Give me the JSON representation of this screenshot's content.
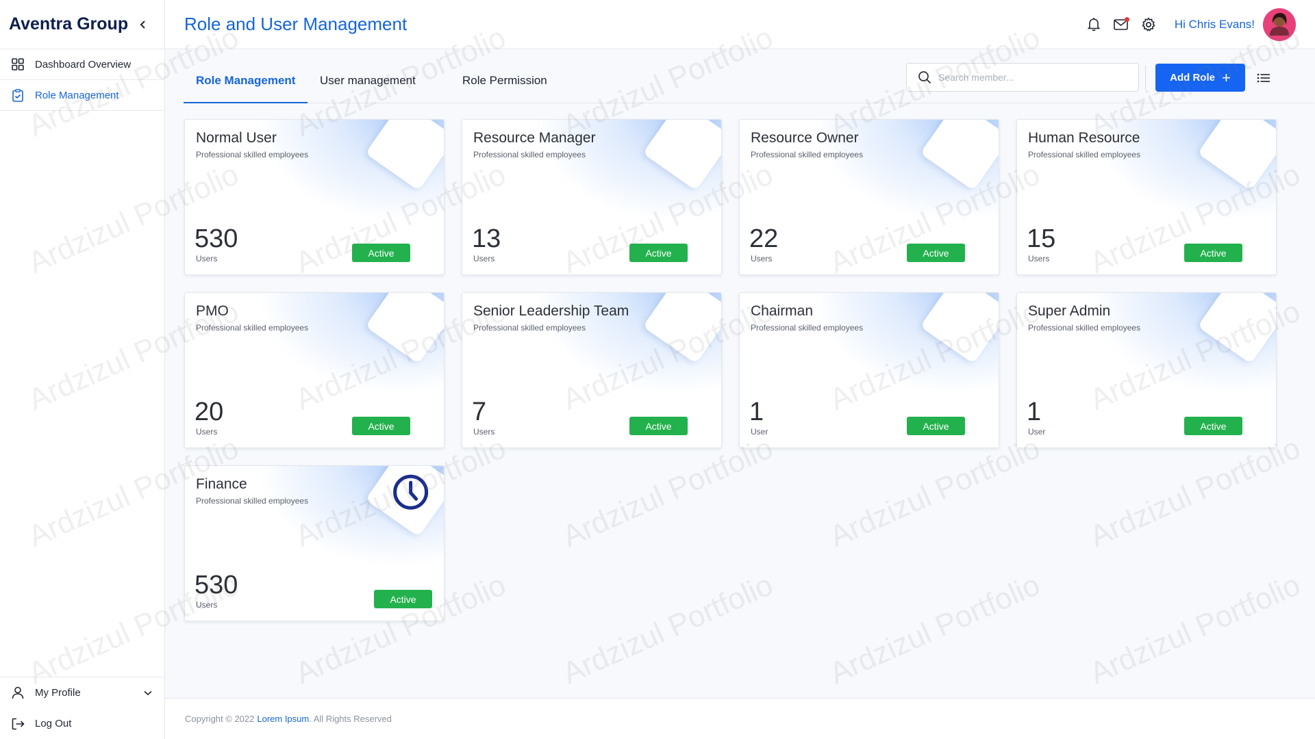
{
  "sidebar": {
    "brand": "Aventra Group",
    "items": [
      {
        "label": "Dashboard Overview",
        "icon": "grid-icon",
        "active": false
      },
      {
        "label": "Role Management",
        "icon": "clipboard-check-icon",
        "active": true
      }
    ],
    "bottom": {
      "profile_label": "My Profile",
      "logout_label": "Log Out"
    }
  },
  "header": {
    "title": "Role and User Management",
    "greeting": "Hi Chris Evans!"
  },
  "tabs": [
    {
      "label": "Role Management",
      "active": true
    },
    {
      "label": "User management",
      "active": false
    },
    {
      "label": "Role Permission",
      "active": false
    }
  ],
  "search": {
    "placeholder": "Search member..."
  },
  "toolbar": {
    "add_label": "Add Role"
  },
  "cards": [
    {
      "title": "Normal User",
      "subtitle": "Professional skilled employees",
      "count": "530",
      "unit": "Users",
      "status": "Active"
    },
    {
      "title": "Resource Manager",
      "subtitle": "Professional skilled employees",
      "count": "13",
      "unit": "Users",
      "status": "Active"
    },
    {
      "title": "Resource Owner",
      "subtitle": "Professional skilled employees",
      "count": "22",
      "unit": "Users",
      "status": "Active"
    },
    {
      "title": "Human Resource",
      "subtitle": "Professional skilled employees",
      "count": "15",
      "unit": "Users",
      "status": "Active"
    },
    {
      "title": "PMO",
      "subtitle": "Professional skilled employees",
      "count": "20",
      "unit": "Users",
      "status": "Active"
    },
    {
      "title": "Senior Leadership Team",
      "subtitle": "Professional skilled employees",
      "count": "7",
      "unit": "Users",
      "status": "Active"
    },
    {
      "title": "Chairman",
      "subtitle": "Professional skilled employees",
      "count": "1",
      "unit": "User",
      "status": "Active"
    },
    {
      "title": "Super Admin",
      "subtitle": "Professional skilled employees",
      "count": "1",
      "unit": "User",
      "status": "Active"
    },
    {
      "title": "Finance",
      "subtitle": "Professional skilled employees",
      "count": "530",
      "unit": "Users",
      "status": "Active"
    }
  ],
  "footer": {
    "prefix": "Copyright © 2022",
    "link": "Lorem Ipsum",
    "suffix": ". All Rights Reserved"
  },
  "watermark_text": "Ardzizul Portfolio",
  "colors": {
    "accent": "#1565d8",
    "button": "#1565f2",
    "status_active": "#23b14d",
    "brand": "#0e1f4d",
    "notification_dot": "#e53935"
  }
}
